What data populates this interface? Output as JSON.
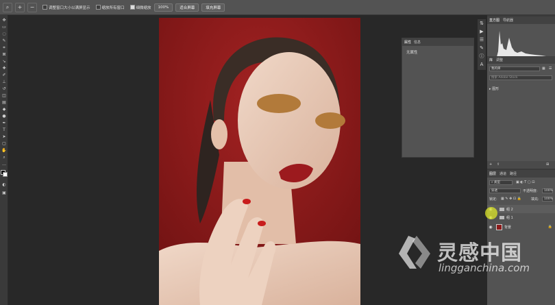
{
  "options_bar": {
    "zoom_icon": "zoom-icon",
    "resize_windows_label": "调整窗口大小以满屏显示",
    "zoom_all_label": "缩放所有窗口",
    "scrubby_zoom_label": "细微缩放",
    "zoom_value": "100%",
    "fit_screen_label": "适合屏幕",
    "fill_screen_label": "填充屏幕"
  },
  "properties_panel": {
    "tabs": [
      "属性",
      "信息"
    ],
    "no_properties": "无属性"
  },
  "histogram_panel": {
    "tabs": [
      "直方图",
      "导航器"
    ]
  },
  "library_panel": {
    "tabs": [
      "库",
      "调整"
    ],
    "library_name": "我的库",
    "search_placeholder": "搜索 Adobe Stock",
    "group_label": "图形"
  },
  "layers_panel": {
    "tabs": [
      "图层",
      "通道",
      "路径"
    ],
    "filter_label": "类型",
    "blend_mode": "穿透",
    "opacity_label": "不透明度:",
    "opacity_value": "100%",
    "lock_label": "锁定:",
    "fill_label": "填充:",
    "fill_value": "100%",
    "layers": [
      {
        "name": "组 2",
        "type": "group",
        "visible": true
      },
      {
        "name": "组 1",
        "type": "group",
        "visible": true
      },
      {
        "name": "背景",
        "type": "background",
        "visible": true
      }
    ]
  },
  "watermark": {
    "brand_cn": "灵感中国",
    "brand_url": "lingganchina.com"
  },
  "colors": {
    "photo_background": "#8c1a1a",
    "ui_dark": "#282828",
    "panel": "#535353"
  }
}
